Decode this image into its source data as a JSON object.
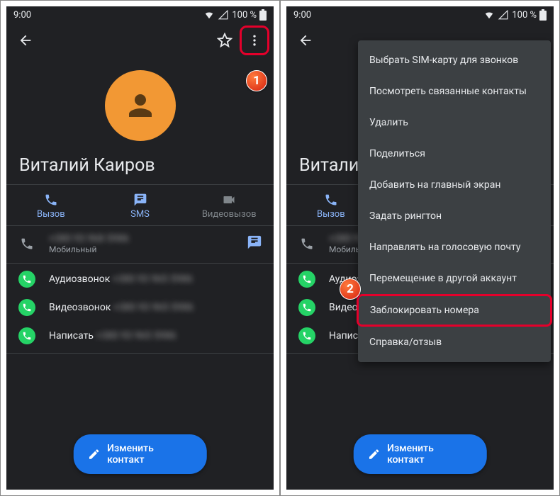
{
  "status": {
    "time": "9:00",
    "battery": "100 %"
  },
  "contact": {
    "name": "Виталий Каиров",
    "tabs": {
      "call": "Вызов",
      "sms": "SMS",
      "video": "Видеовызов"
    },
    "phone": {
      "number": "+380 93 968 5986",
      "type": "Мобильный"
    },
    "whatsapp": {
      "audio": "Аудиозвонок",
      "video": "Видеозвонок",
      "message": "Написать",
      "num_a": "+380 93 965 5986",
      "num_b": "+380 93 965 5986",
      "num_c": "+380 93 965 5986"
    },
    "fab": "Изменить контакт"
  },
  "menu": {
    "items": [
      "Выбрать SIM-карту для звонков",
      "Посмотреть связанные контакты",
      "Удалить",
      "Поделиться",
      "Добавить на главный экран",
      "Задать рингтон",
      "Направлять на голосовую почту",
      "Перемещение в другой аккаунт",
      "Заблокировать номера",
      "Справка/отзыв"
    ]
  },
  "annotations": {
    "b1": "1",
    "b2": "2"
  }
}
